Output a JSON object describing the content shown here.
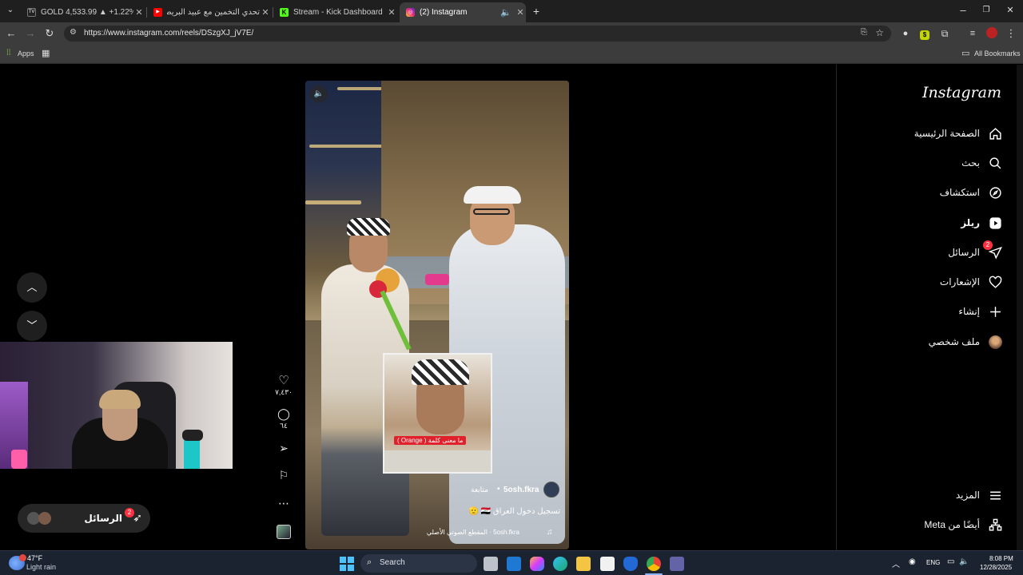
{
  "browser": {
    "tabs": [
      {
        "title": "GOLD 4,533.99 ▲ +1.22% Unn",
        "fav_color": "#222222",
        "fav_text": "TV"
      },
      {
        "title": "تحدي التخمين مع عبيد البريطاني",
        "fav_color": "#ff0000",
        "fav_text": "▶"
      },
      {
        "title": "Stream - Kick Dashboard",
        "fav_color": "#53fc18",
        "fav_text": "K"
      },
      {
        "title": "(2) Instagram",
        "fav_color": "#d62976",
        "fav_text": "◎"
      }
    ],
    "url": "https://www.instagram.com/reels/DSzgXJ_jV7E/",
    "bookmarks": {
      "apps_label": "Apps",
      "all_bookmarks_label": "All Bookmarks"
    }
  },
  "instagram": {
    "logo": "Instagram",
    "nav": [
      {
        "label": "الصفحة الرئيسية",
        "icon": "home-icon"
      },
      {
        "label": "بحث",
        "icon": "search-icon"
      },
      {
        "label": "استكشاف",
        "icon": "compass-icon"
      },
      {
        "label": "ريلز",
        "icon": "reels-icon"
      },
      {
        "label": "الرسائل",
        "icon": "messenger-icon",
        "badge": "2"
      },
      {
        "label": "الإشعارات",
        "icon": "heart-icon"
      },
      {
        "label": "إنشاء",
        "icon": "plus-icon"
      },
      {
        "label": "ملف شخصي",
        "icon": "avatar-icon"
      }
    ],
    "more_label": "المزيد",
    "meta_label": "أيضًا من Meta",
    "reel": {
      "username": "5osh.fkra",
      "follow_label": "متابعة",
      "caption": "تسجيل دخول العراق 🇮🇶 🫡",
      "audio": "5osh.fkra · المقطع الصوتي الأصلي",
      "overlay_text": "ما معنى كلمة ( Orange )",
      "likes": "٧,٤٣٠",
      "comments": "٦٤"
    },
    "messages_pill_label": "الرسائل",
    "messages_pill_badge": "2"
  },
  "taskbar": {
    "weather_temp": "47°F",
    "weather_desc": "Light rain",
    "search_placeholder": "Search",
    "lang": "ENG",
    "time": "8:08 PM",
    "date": "12/28/2025"
  }
}
